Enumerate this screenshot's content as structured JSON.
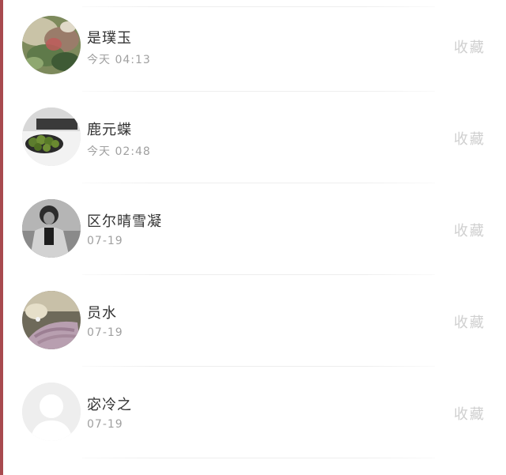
{
  "favorites_list": {
    "items": [
      {
        "name": "是璞玉",
        "time": "今天 04:13",
        "action": "收藏",
        "avatar": "photo-plants-icon"
      },
      {
        "name": "鹿元蝶",
        "time": "今天 02:48",
        "action": "收藏",
        "avatar": "photo-food-bowl-icon"
      },
      {
        "name": "区尔晴雪凝",
        "time": "07-19",
        "action": "收藏",
        "avatar": "photo-person-bw-icon"
      },
      {
        "name": "员水",
        "time": "07-19",
        "action": "收藏",
        "avatar": "photo-hand-icon"
      },
      {
        "name": "宓冷之",
        "time": "07-19",
        "action": "收藏",
        "avatar": "default-avatar-icon"
      }
    ]
  },
  "colors": {
    "accent_bar": "#a84a4f",
    "name_text": "#333333",
    "time_text": "#a0a0a0",
    "action_text": "#cfcfcf"
  }
}
